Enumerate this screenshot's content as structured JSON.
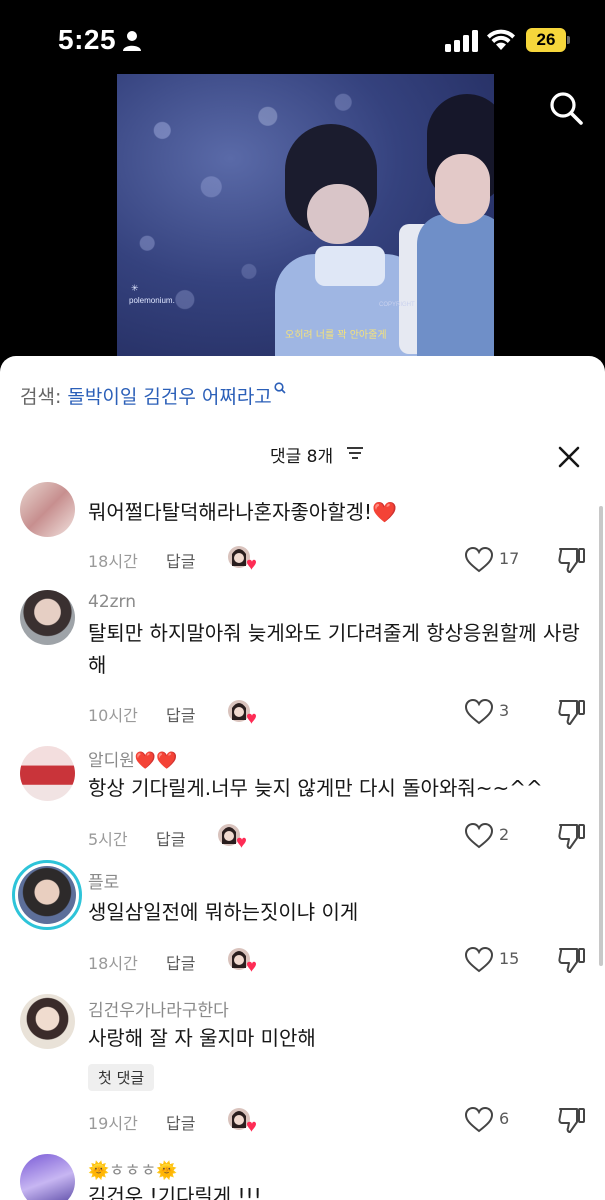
{
  "status_bar": {
    "time": "5:25",
    "battery": "26"
  },
  "video": {
    "watermark": "polemonium.",
    "subtitle": "오히려 너를 꽉 안아줄게",
    "copyright": "COPYRIGHT"
  },
  "search": {
    "prefix": "검색:",
    "query": "돌박이일 김건우 어쩌라고"
  },
  "sheet": {
    "title": "댓글 8개"
  },
  "comments": [
    {
      "username": "",
      "text": "뭐어쩔다탈덕해라나혼자좋아할겡!❤️",
      "time": "18시간",
      "reply": "답글",
      "likes": "17"
    },
    {
      "username": "42zrn",
      "text": "탈퇴만 하지말아줘 늦게와도 기다려줄게 항상응원할께 사랑해",
      "time": "10시간",
      "reply": "답글",
      "likes": "3"
    },
    {
      "username": "알디원❤️❤️",
      "text": "항상 기다릴게.너무 늦지 않게만 다시 돌아와줘~~^^",
      "time": "5시간",
      "reply": "답글",
      "likes": "2"
    },
    {
      "username": "플로",
      "text": "생일삼일전에 뭐하는짓이냐 이게",
      "time": "18시간",
      "reply": "답글",
      "likes": "15"
    },
    {
      "username": "김건우가나라구한다",
      "text": "사랑해 잘 자 울지마 미안해",
      "badge": "첫 댓글",
      "time": "19시간",
      "reply": "답글",
      "likes": "6"
    },
    {
      "username": "🌞ㅎㅎㅎ🌞",
      "text": "김건우 !기다릴게 !!!"
    }
  ],
  "colors": {
    "accent_link": "#2b5fb8",
    "heart_red": "#d9222e",
    "ring": "#2ec4d9",
    "battery": "#f6d63b"
  }
}
